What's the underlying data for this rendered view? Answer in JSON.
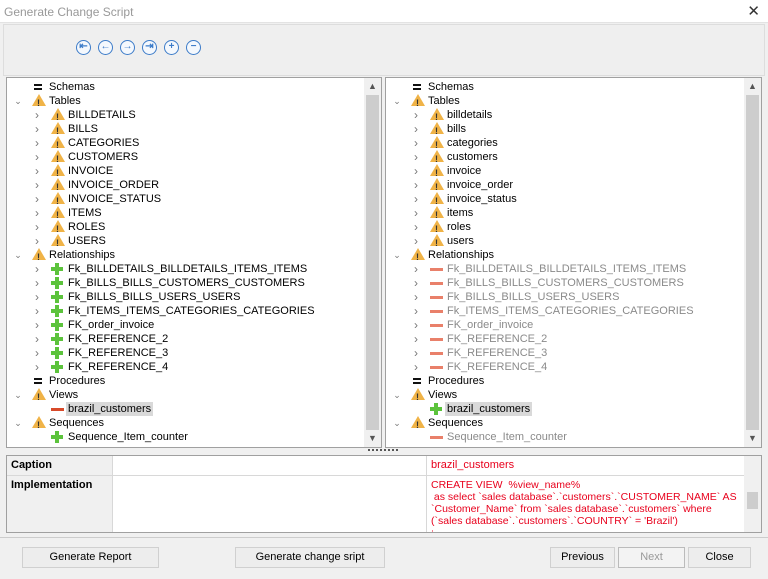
{
  "window": {
    "title": "Generate Change Script",
    "close_icon": "close-icon"
  },
  "toolbar": {
    "buttons": [
      {
        "name": "first-icon",
        "glyph": "⇤"
      },
      {
        "name": "previous-icon",
        "glyph": "←"
      },
      {
        "name": "next-icon",
        "glyph": "→"
      },
      {
        "name": "last-icon",
        "glyph": "⇥"
      },
      {
        "name": "expand-icon",
        "glyph": "+"
      },
      {
        "name": "collapse-icon",
        "glyph": "−"
      }
    ]
  },
  "left_tree": [
    {
      "level": 0,
      "exp": "",
      "icon": "eq",
      "label": "Schemas"
    },
    {
      "level": 0,
      "exp": "open",
      "icon": "warn",
      "label": "Tables"
    },
    {
      "level": 1,
      "exp": "closed",
      "icon": "warn",
      "label": "BILLDETAILS"
    },
    {
      "level": 1,
      "exp": "closed",
      "icon": "warn",
      "label": "BILLS"
    },
    {
      "level": 1,
      "exp": "closed",
      "icon": "warn",
      "label": "CATEGORIES"
    },
    {
      "level": 1,
      "exp": "closed",
      "icon": "warn",
      "label": "CUSTOMERS"
    },
    {
      "level": 1,
      "exp": "closed",
      "icon": "warn",
      "label": "INVOICE"
    },
    {
      "level": 1,
      "exp": "closed",
      "icon": "warn",
      "label": "INVOICE_ORDER"
    },
    {
      "level": 1,
      "exp": "closed",
      "icon": "warn",
      "label": "INVOICE_STATUS"
    },
    {
      "level": 1,
      "exp": "closed",
      "icon": "warn",
      "label": "ITEMS"
    },
    {
      "level": 1,
      "exp": "closed",
      "icon": "warn",
      "label": "ROLES"
    },
    {
      "level": 1,
      "exp": "closed",
      "icon": "warn",
      "label": "USERS"
    },
    {
      "level": 0,
      "exp": "open",
      "icon": "warn",
      "label": "Relationships"
    },
    {
      "level": 1,
      "exp": "closed",
      "icon": "plus",
      "label": "Fk_BILLDETAILS_BILLDETAILS_ITEMS_ITEMS"
    },
    {
      "level": 1,
      "exp": "closed",
      "icon": "plus",
      "label": "Fk_BILLS_BILLS_CUSTOMERS_CUSTOMERS"
    },
    {
      "level": 1,
      "exp": "closed",
      "icon": "plus",
      "label": "Fk_BILLS_BILLS_USERS_USERS"
    },
    {
      "level": 1,
      "exp": "closed",
      "icon": "plus",
      "label": "Fk_ITEMS_ITEMS_CATEGORIES_CATEGORIES"
    },
    {
      "level": 1,
      "exp": "closed",
      "icon": "plus",
      "label": "FK_order_invoice"
    },
    {
      "level": 1,
      "exp": "closed",
      "icon": "plus",
      "label": "FK_REFERENCE_2"
    },
    {
      "level": 1,
      "exp": "closed",
      "icon": "plus",
      "label": "FK_REFERENCE_3"
    },
    {
      "level": 1,
      "exp": "closed",
      "icon": "plus",
      "label": "FK_REFERENCE_4"
    },
    {
      "level": 0,
      "exp": "",
      "icon": "eq",
      "label": "Procedures"
    },
    {
      "level": 0,
      "exp": "open",
      "icon": "warn",
      "label": "Views"
    },
    {
      "level": 1,
      "exp": "",
      "icon": "minus red",
      "label": "brazil_customers",
      "selected": true
    },
    {
      "level": 0,
      "exp": "open",
      "icon": "warn",
      "label": "Sequences"
    },
    {
      "level": 1,
      "exp": "",
      "icon": "plus",
      "label": "Sequence_Item_counter"
    }
  ],
  "right_tree": [
    {
      "level": 0,
      "exp": "",
      "icon": "eq",
      "label": "Schemas"
    },
    {
      "level": 0,
      "exp": "open",
      "icon": "warn",
      "label": "Tables"
    },
    {
      "level": 1,
      "exp": "closed",
      "icon": "warn",
      "label": "billdetails"
    },
    {
      "level": 1,
      "exp": "closed",
      "icon": "warn",
      "label": "bills"
    },
    {
      "level": 1,
      "exp": "closed",
      "icon": "warn",
      "label": "categories"
    },
    {
      "level": 1,
      "exp": "closed",
      "icon": "warn",
      "label": "customers"
    },
    {
      "level": 1,
      "exp": "closed",
      "icon": "warn",
      "label": "invoice"
    },
    {
      "level": 1,
      "exp": "closed",
      "icon": "warn",
      "label": "invoice_order"
    },
    {
      "level": 1,
      "exp": "closed",
      "icon": "warn",
      "label": "invoice_status"
    },
    {
      "level": 1,
      "exp": "closed",
      "icon": "warn",
      "label": "items"
    },
    {
      "level": 1,
      "exp": "closed",
      "icon": "warn",
      "label": "roles"
    },
    {
      "level": 1,
      "exp": "closed",
      "icon": "warn",
      "label": "users"
    },
    {
      "level": 0,
      "exp": "open",
      "icon": "warn",
      "label": "Relationships"
    },
    {
      "level": 1,
      "exp": "closed",
      "icon": "minus",
      "label": "Fk_BILLDETAILS_BILLDETAILS_ITEMS_ITEMS",
      "gray": true
    },
    {
      "level": 1,
      "exp": "closed",
      "icon": "minus",
      "label": "Fk_BILLS_BILLS_CUSTOMERS_CUSTOMERS",
      "gray": true
    },
    {
      "level": 1,
      "exp": "closed",
      "icon": "minus",
      "label": "Fk_BILLS_BILLS_USERS_USERS",
      "gray": true
    },
    {
      "level": 1,
      "exp": "closed",
      "icon": "minus",
      "label": "Fk_ITEMS_ITEMS_CATEGORIES_CATEGORIES",
      "gray": true
    },
    {
      "level": 1,
      "exp": "closed",
      "icon": "minus",
      "label": "FK_order_invoice",
      "gray": true
    },
    {
      "level": 1,
      "exp": "closed",
      "icon": "minus",
      "label": "FK_REFERENCE_2",
      "gray": true
    },
    {
      "level": 1,
      "exp": "closed",
      "icon": "minus",
      "label": "FK_REFERENCE_3",
      "gray": true
    },
    {
      "level": 1,
      "exp": "closed",
      "icon": "minus",
      "label": "FK_REFERENCE_4",
      "gray": true
    },
    {
      "level": 0,
      "exp": "",
      "icon": "eq",
      "label": "Procedures"
    },
    {
      "level": 0,
      "exp": "open",
      "icon": "warn",
      "label": "Views"
    },
    {
      "level": 1,
      "exp": "",
      "icon": "plus",
      "label": "brazil_customers",
      "selected": true
    },
    {
      "level": 0,
      "exp": "open",
      "icon": "warn",
      "label": "Sequences"
    },
    {
      "level": 1,
      "exp": "",
      "icon": "minus",
      "label": "Sequence_Item_counter",
      "gray": true
    }
  ],
  "properties": {
    "caption_label": "Caption",
    "caption_left": "",
    "caption_right": "brazil_customers",
    "impl_label": "Implementation",
    "impl_left": "",
    "impl_right": "CREATE VIEW  %view_name%\n as select `sales database`.`customers`.`CUSTOMER_NAME` AS `Customer_Name` from `sales database`.`customers` where (`sales database`.`customers`.`COUNTRY` = 'Brazil')\n;"
  },
  "buttons": {
    "report": "Generate Report",
    "script": "Generate change sript",
    "previous": "Previous",
    "next": "Next",
    "close": "Close"
  }
}
